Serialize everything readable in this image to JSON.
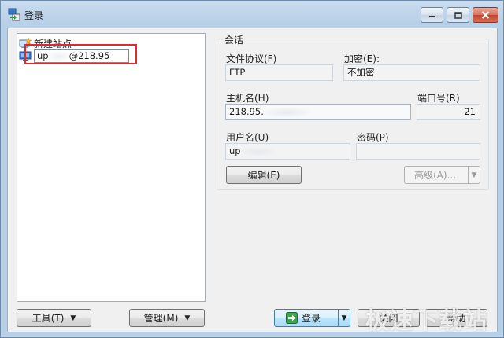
{
  "window": {
    "title": "登录"
  },
  "colors": {
    "highlight_box": "#e0282e",
    "title_gradient": "#b7cfe7"
  },
  "tree": {
    "items": [
      {
        "label": "新建站点",
        "icon": "new-site-icon"
      },
      {
        "label_prefix": "up",
        "label_suffix": "@218.95",
        "icon": "computer-icon",
        "editing": true
      }
    ]
  },
  "session": {
    "group_title": "会话",
    "protocol_label": "文件协议(F)",
    "protocol_value": "FTP",
    "encryption_label": "加密(E):",
    "encryption_value": "不加密",
    "host_label": "主机名(H)",
    "host_value": "218.95.",
    "port_label": "端口号(R)",
    "port_value": "21",
    "user_label": "用户名(U)",
    "user_value": "up",
    "password_label": "密码(P)",
    "password_value": "",
    "edit_button": "编辑(E)",
    "advanced_button": "高级(A)..."
  },
  "footer": {
    "tools_button": "工具(T)",
    "manage_button": "管理(M)",
    "login_button": "登录",
    "close_button": "关闭",
    "help_button": "帮助"
  },
  "watermark": "极速下载站"
}
